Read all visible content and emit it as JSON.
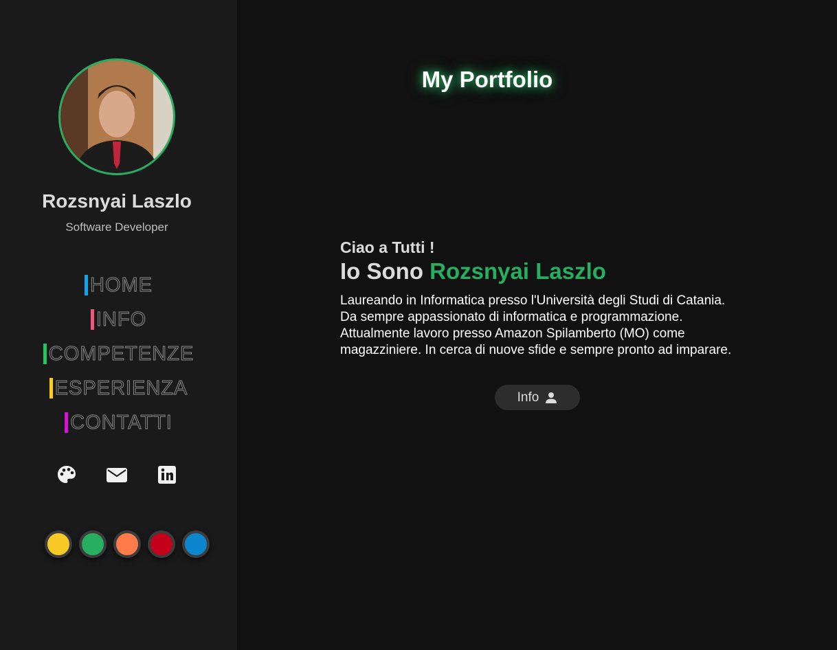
{
  "profile": {
    "name": "Rozsnyai Laszlo",
    "role": "Software Developer"
  },
  "nav": {
    "items": [
      {
        "label": "HOME",
        "accent": "#0ea5e9"
      },
      {
        "label": "INFO",
        "accent": "#f0567a"
      },
      {
        "label": "COMPETENZE",
        "accent": "#22c55e"
      },
      {
        "label": "ESPERIENZA",
        "accent": "#facc15"
      },
      {
        "label": "CONTATTI",
        "accent": "#d812d8"
      }
    ]
  },
  "socials": [
    {
      "icon": "palette-icon"
    },
    {
      "icon": "envelope-icon"
    },
    {
      "icon": "linkedin-icon"
    }
  ],
  "theme_colors": [
    "#f8c927",
    "#27ae60",
    "#ff7b4a",
    "#c4001a",
    "#0d86d0"
  ],
  "header": {
    "title": "My Portfolio"
  },
  "hero": {
    "greeting": "Ciao a Tutti !",
    "intro_prefix": "Io Sono",
    "intro_name": "Rozsnyai Laszlo",
    "bio": "Laureando in Informatica presso l'Università degli Studi di Catania. Da sempre appassionato di informatica e programmazione. Attualmente lavoro presso Amazon Spilamberto (MO) come magazziniere. In cerca di nuove sfide e sempre pronto ad imparare.",
    "button_label": "Info"
  },
  "colors": {
    "accent": "#27ae60",
    "sidebar_bg": "#1a1a1a",
    "main_bg": "#111111"
  }
}
